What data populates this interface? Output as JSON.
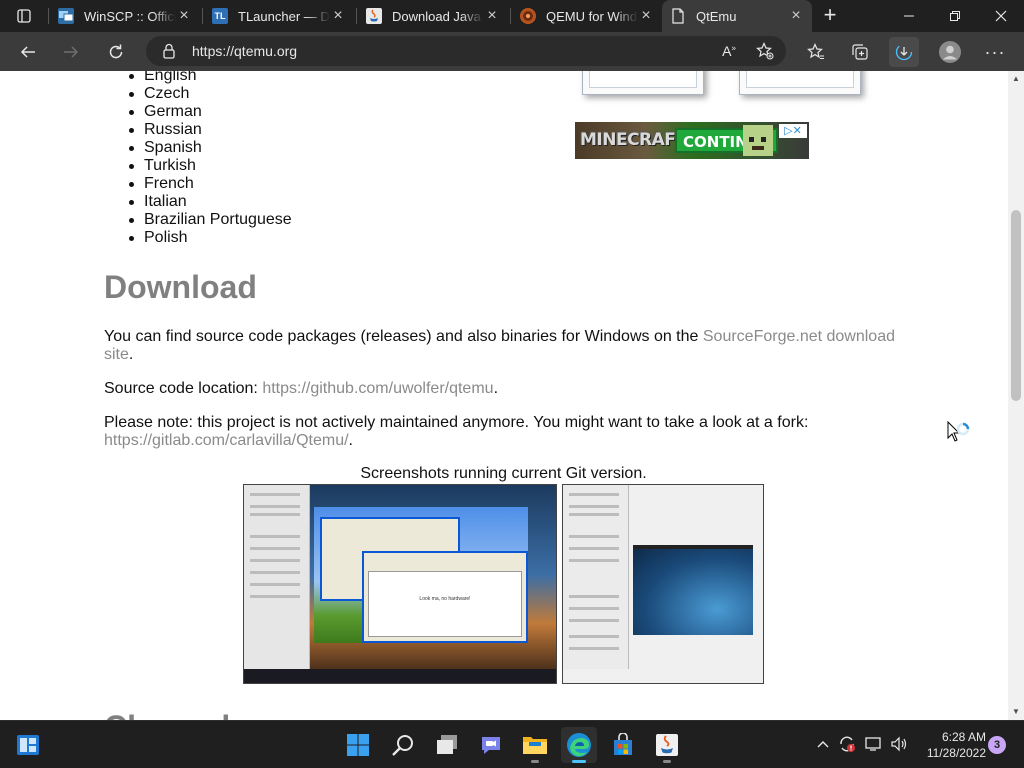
{
  "browser": {
    "tabs": [
      {
        "label": "WinSCP :: Official Site",
        "favicon": "winscp-icon",
        "active": false
      },
      {
        "label": "TLauncher — Download",
        "favicon": "tlauncher-icon",
        "favicon_text": "TL",
        "active": false
      },
      {
        "label": "Download Java for Windows",
        "favicon": "java-icon",
        "active": false
      },
      {
        "label": "QEMU for Windows",
        "favicon": "qemu-icon",
        "active": false
      },
      {
        "label": "QtEmu",
        "favicon": "page-icon",
        "active": true
      }
    ],
    "url": "https://qtemu.org",
    "colors": {
      "tabstrip": "#202020",
      "toolbar": "#3b3b3b",
      "text": "#e8e8e8"
    }
  },
  "page": {
    "languages": [
      "English",
      "Czech",
      "German",
      "Russian",
      "Spanish",
      "Turkish",
      "French",
      "Italian",
      "Brazilian Portuguese",
      "Polish"
    ],
    "ad": {
      "logo": "MINECRAFT",
      "cta": "CONTINUE"
    },
    "download_heading": "Download",
    "p1_text": "You can find source code packages (releases) and also binaries for Windows on the ",
    "p1_link": "SourceForge.net download site",
    "p1_end": ".",
    "p2_text": "Source code location: ",
    "p2_link": "https://github.com/uwolfer/qtemu",
    "p2_end": ".",
    "p3_text": "Please note: this project is not actively maintained anymore. You might want to take a look at a fork: ",
    "p3_link": "https://gitlab.com/carlavilla/Qtemu/",
    "p3_end": ".",
    "screenshots_caption": "Screenshots running current Git version.",
    "screenshot1_doc_text": "Look ma, no hardware!",
    "next_heading_partial": "Changelog",
    "link_color": "#8a8a8a",
    "heading_color": "#808080"
  },
  "taskbar": {
    "apps": [
      {
        "name": "start-icon"
      },
      {
        "name": "search-icon"
      },
      {
        "name": "task-view-icon"
      },
      {
        "name": "chat-icon"
      },
      {
        "name": "file-explorer-icon"
      },
      {
        "name": "edge-icon"
      },
      {
        "name": "store-icon"
      },
      {
        "name": "java-icon"
      }
    ],
    "time": "6:28 AM",
    "date": "11/28/2022",
    "notifications": "3"
  }
}
